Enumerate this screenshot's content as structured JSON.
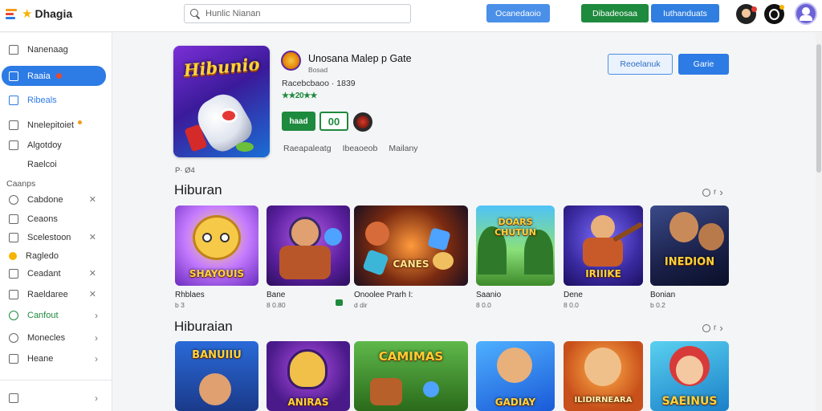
{
  "header": {
    "logo_text": "Dhagia",
    "search_placeholder": "Hunlic Nianan",
    "buttons": [
      "Ocanedaoio",
      "Dibadeosaa",
      "Iuthanduats"
    ]
  },
  "sidebar": {
    "items": [
      {
        "label": "Nanenaag"
      },
      {
        "label": "Raaia"
      },
      {
        "label": "Ribeals"
      },
      {
        "label": "Nnelepitoiet"
      },
      {
        "label": "Algotdoy"
      },
      {
        "label": "Raelcoi"
      }
    ],
    "section_label": "Caanps",
    "section_items": [
      {
        "label": "Cabdone"
      },
      {
        "label": "Ceaons"
      },
      {
        "label": "Scelestoon"
      },
      {
        "label": "Ragledo"
      },
      {
        "label": "Ceadant"
      },
      {
        "label": "Raeldaree"
      },
      {
        "label": "Canfout"
      },
      {
        "label": "Monecles"
      },
      {
        "label": "Heane"
      }
    ]
  },
  "hero": {
    "art_text": "Hibunio",
    "title": "Unosana Malep p Gate",
    "subtitle": "Bosad",
    "meta": "Racebcbaoo · 1839",
    "stars": "★★20★★",
    "chip_1": "haad",
    "chip_2": "00",
    "tabs": [
      "Raeapaleatg",
      "Ibeaoeob",
      "Mailany"
    ],
    "btn_secondary": "Reoelanuk",
    "btn_primary": "Garie",
    "foot": "P· Ø4"
  },
  "sections": [
    {
      "title": "Hiburan",
      "cards": [
        {
          "art_text": "SHAYOUIS",
          "label": "Rhblaes",
          "sub": "b 3"
        },
        {
          "art_text": "",
          "label": "Bane",
          "sub": "8 0.80"
        },
        {
          "art_text": "CANES",
          "label": "Onoolee Prarh I:",
          "sub": "d dir"
        },
        {
          "art_text": "DOARS CHUTUN",
          "label": "Saanio",
          "sub": "8 0.0"
        },
        {
          "art_text": "IRIIIKE",
          "label": "Dene",
          "sub": "8 0.0"
        },
        {
          "art_text": "INEDION",
          "label": "Bonian",
          "sub": "b 0.2"
        }
      ]
    },
    {
      "title": "Hiburaian",
      "cards": [
        {
          "art_text": "BANUIIU",
          "label": "",
          "sub": ""
        },
        {
          "art_text": "ANIRAS",
          "label": "",
          "sub": ""
        },
        {
          "art_text": "CAMIMAS",
          "label": "",
          "sub": ""
        },
        {
          "art_text": "GADIAY",
          "label": "",
          "sub": ""
        },
        {
          "art_text": "ILIDIRNEARA",
          "label": "",
          "sub": ""
        },
        {
          "art_text": "SAEINUS",
          "label": "",
          "sub": ""
        }
      ]
    }
  ],
  "colors": {
    "accent": "#2d7be5",
    "green": "#1e8a3e",
    "star": "#f6b300"
  }
}
